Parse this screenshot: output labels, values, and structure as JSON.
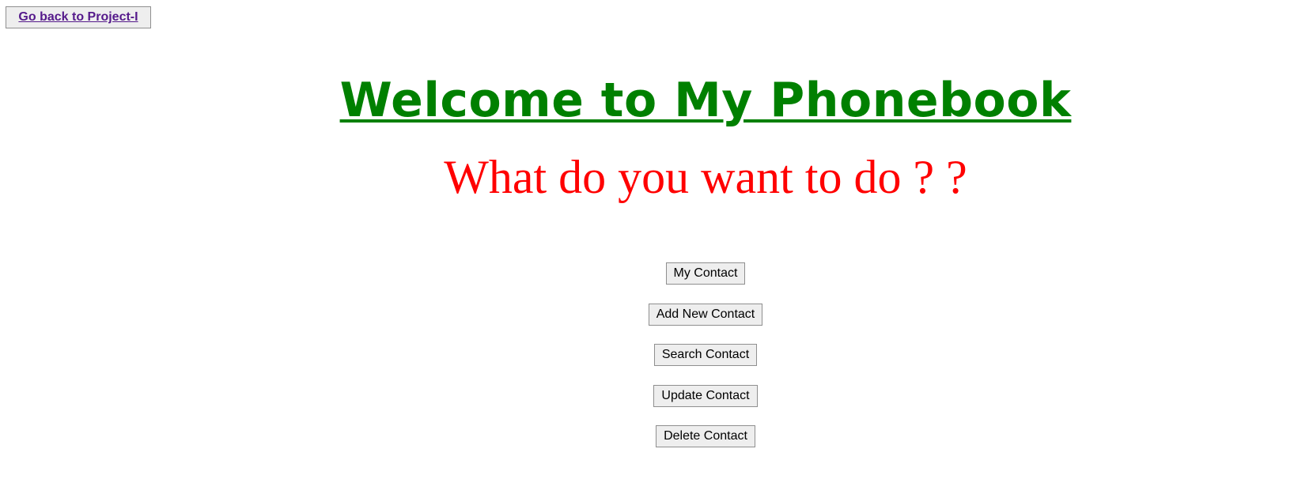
{
  "back_link": {
    "label": "Go back to Project-I"
  },
  "header": {
    "title": "Welcome to My Phonebook",
    "subtitle": "What do you want to do ? ?"
  },
  "actions": [
    {
      "label": "My Contact"
    },
    {
      "label": "Add New Contact"
    },
    {
      "label": "Search Contact"
    },
    {
      "label": "Update Contact"
    },
    {
      "label": "Delete Contact"
    }
  ],
  "colors": {
    "title": "#008000",
    "subtitle": "#ff0000",
    "visited_link": "#551a8b",
    "button_bg": "#eeeeee"
  }
}
